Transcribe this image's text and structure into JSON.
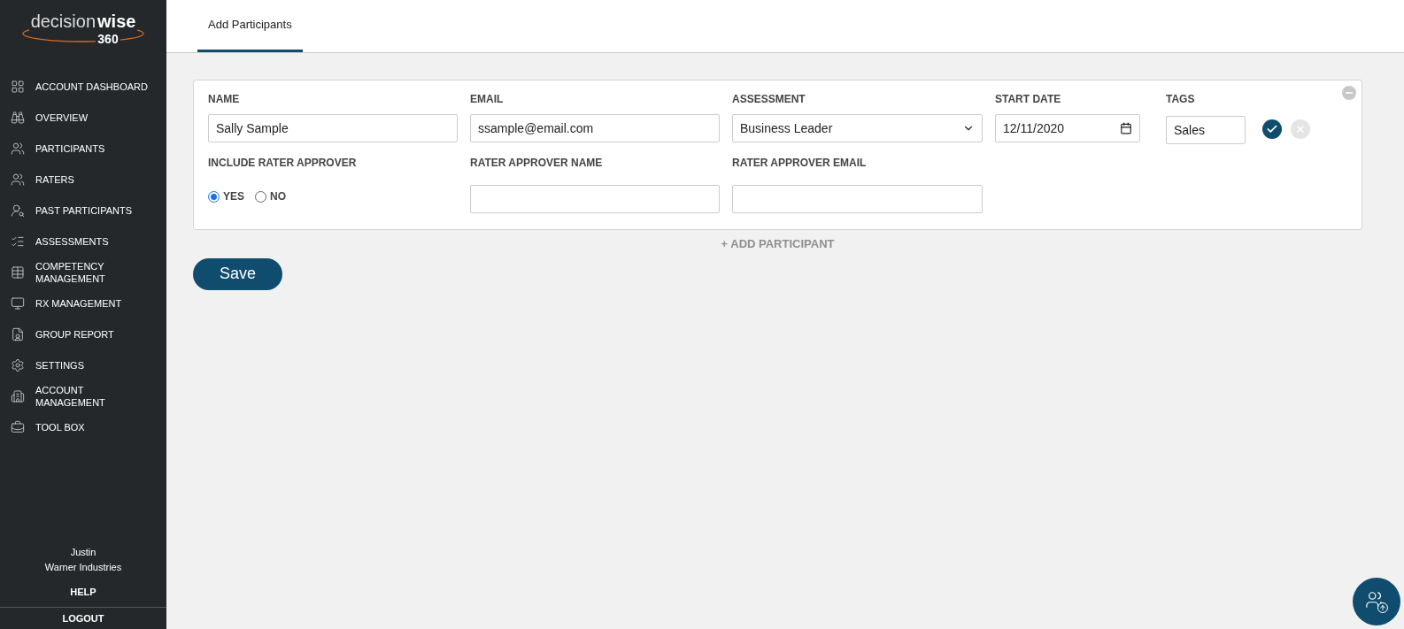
{
  "logo": {
    "part_1": "decision",
    "part_2": "wise",
    "part_3": "360"
  },
  "sidebar": {
    "items": [
      {
        "label": "ACCOUNT DASHBOARD",
        "selected": false
      },
      {
        "label": "OVERVIEW",
        "selected": false
      },
      {
        "label": "PARTICIPANTS",
        "selected": false
      },
      {
        "label": "RATERS",
        "selected": false
      },
      {
        "label": "PAST PARTICIPANTS",
        "selected": false
      },
      {
        "label": "ASSESSMENTS",
        "selected": false
      },
      {
        "label": "COMPETENCY MANAGEMENT",
        "selected": false
      },
      {
        "label": "RX MANAGEMENT",
        "selected": false
      },
      {
        "label": "GROUP REPORT",
        "selected": false
      },
      {
        "label": "SETTINGS",
        "selected": false
      },
      {
        "label": "ACCOUNT MANAGEMENT",
        "selected": false
      },
      {
        "label": "TOOL BOX",
        "selected": false
      }
    ],
    "user_name": "Justin",
    "company": "Warner Industries",
    "help": "HELP",
    "logout": "LOGOUT"
  },
  "tabs": [
    {
      "label": "Add Participants",
      "selected": true
    }
  ],
  "participant": {
    "name": {
      "label": "NAME",
      "value": "Sally Sample"
    },
    "email": {
      "label": "EMAIL",
      "value": "ssample@email.com"
    },
    "assessment": {
      "label": "ASSESSMENT",
      "value": "Business Leader"
    },
    "start_date": {
      "label": "START DATE",
      "value": "12/11/2020"
    },
    "tags": {
      "label": "TAGS",
      "value": "Sales"
    },
    "include_rater_approver": {
      "label": "INCLUDE RATER APPROVER",
      "options": [
        {
          "label": "YES",
          "selected": true
        },
        {
          "label": "NO",
          "selected": false
        }
      ]
    },
    "rater_approver_name": {
      "label": "RATER APPROVER NAME"
    },
    "rater_approver_email": {
      "label": "RATER APPROVER EMAIL"
    }
  },
  "add_participant": "+ ADD PARTICIPANT",
  "save_button": "Save"
}
